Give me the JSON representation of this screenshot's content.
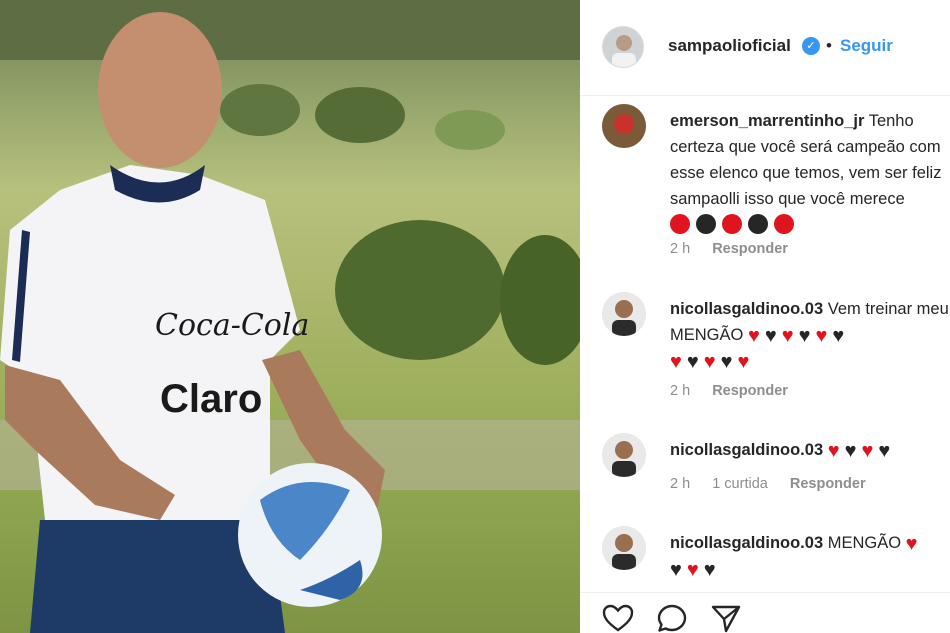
{
  "post": {
    "username": "sampaolioficial",
    "follow_label": "Seguir",
    "separator": "•"
  },
  "comments": [
    {
      "username": "emerson_marrentinho_jr",
      "text": "Tenho certeza que você será campeão com esse elenco que temos, vem ser feliz sampaolli isso que você merece",
      "emoji": [
        "red",
        "dark",
        "red",
        "dark",
        "red"
      ],
      "time": "2 h",
      "reply_label": "Responder"
    },
    {
      "username": "nicollasgaldinoo.03",
      "text": "Vem treinar meu MENGÃO",
      "emoji_line1": [
        "red",
        "dark",
        "red",
        "dark",
        "red",
        "dark"
      ],
      "emoji_line2": [
        "red",
        "dark",
        "red",
        "dark",
        "red"
      ],
      "time": "2 h",
      "reply_label": "Responder"
    },
    {
      "username": "nicollasgaldinoo.03",
      "emoji": [
        "red",
        "dark",
        "red",
        "dark"
      ],
      "time": "2 h",
      "likes": "1 curtida",
      "reply_label": "Responder"
    },
    {
      "username": "nicollasgaldinoo.03",
      "text": "MENGÃO",
      "emoji_line1": [
        "red"
      ],
      "emoji_line2": [
        "dark",
        "red",
        "dark"
      ]
    }
  ],
  "photo": {
    "shirt_sponsor": "Coca-Cola",
    "shirt_sponsor2": "Claro"
  },
  "icons": {
    "like": "heart-icon",
    "comment": "comment-icon",
    "share": "share-icon",
    "verified": "verified-badge-icon"
  },
  "colors": {
    "link_blue": "#3897f0",
    "heart_red": "#e0141e",
    "muted": "#8e8e8e"
  }
}
